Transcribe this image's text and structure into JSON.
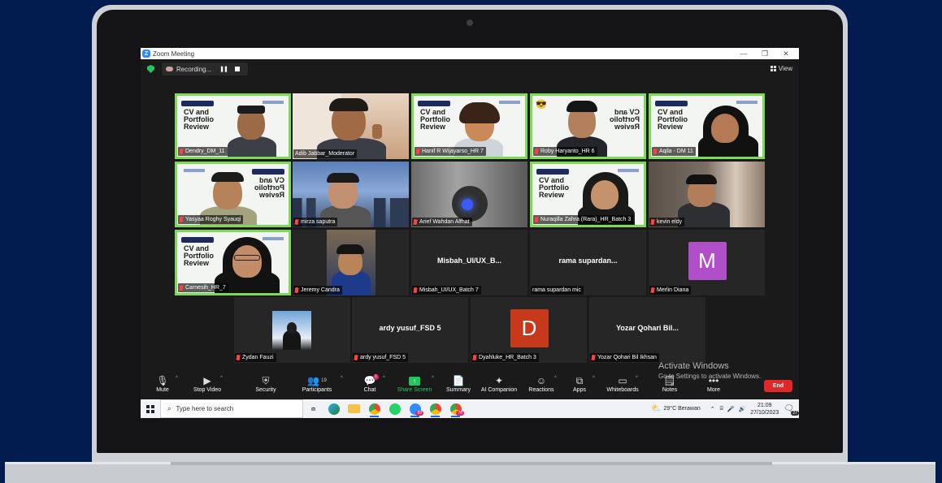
{
  "window": {
    "title": "Zoom Meeting",
    "min": "—",
    "max": "❐",
    "close": "✕"
  },
  "recording": {
    "label": "Recording...",
    "pause": "❚❚"
  },
  "view": {
    "label": "View"
  },
  "participants": [
    {
      "name": "Dendry_DM_11",
      "muted": true,
      "banner": "CV and\nPortfolio\nReview",
      "mirror": false
    },
    {
      "name": "Adib Jabbar_Moderator",
      "muted": false,
      "speaking": true
    },
    {
      "name": "Hanif R Wijayarso_HR 7",
      "muted": true,
      "banner": "CV and\nPortfolio\nReview",
      "mirror": false
    },
    {
      "name": "Roby Haryanto_HR 6",
      "muted": true,
      "banner": "CV and\nPortfolio\nReview",
      "mirror": true
    },
    {
      "name": "Aqila - DM 11",
      "muted": true,
      "banner": "CV and\nPortfolio\nReview",
      "mirror": false
    },
    {
      "name": "Yasyaa Roghy Syauqi",
      "muted": true,
      "banner": "CV and\nPortfolio\nReview",
      "mirror": true
    },
    {
      "name": "mirza saputra",
      "muted": true
    },
    {
      "name": "Arief Wahdan Alfhat",
      "muted": true
    },
    {
      "name": "Nuraqilla Zahra (Rara)_HR_Batch 3",
      "muted": true,
      "banner": "CV and\nPortfolio\nReview",
      "mirror": false
    },
    {
      "name": "kevin eldy",
      "muted": true
    },
    {
      "name": "Carnesih_HR_7",
      "muted": true,
      "banner": "CV and\nPortfolio\nReview",
      "mirror": false
    },
    {
      "name": "Jeremy Candra",
      "muted": true
    },
    {
      "name": "Misbah_UI/UX_Batch 7",
      "muted": true,
      "display": "Misbah_UI/UX_B..."
    },
    {
      "name": "rama supardan mic",
      "muted": false,
      "display": "rama supardan..."
    },
    {
      "name": "Merlin Diana",
      "muted": true,
      "avatar": "M",
      "avatar_color": "#b04fc9"
    },
    {
      "name": "Zydan Fauzi",
      "muted": true
    },
    {
      "name": "ardy yusuf_FSD 5",
      "muted": true,
      "display": "ardy yusuf_FSD 5"
    },
    {
      "name": "Dyahluke_HR_Batch 3",
      "muted": true,
      "avatar": "D",
      "avatar_color": "#c8391c"
    },
    {
      "name": "Yozar Qohari Bil Ikhsan",
      "muted": true,
      "display": "Yozar Qohari Bil..."
    }
  ],
  "toolbar": {
    "mute": "Mute",
    "video": "Stop Video",
    "security": "Security",
    "participants": "Participants",
    "participants_count": "19",
    "chat": "Chat",
    "chat_badge": "1",
    "share": "Share Screen",
    "summary": "Summary",
    "ai": "AI Companion",
    "reactions": "Reactions",
    "apps": "Apps",
    "whiteboards": "Whiteboards",
    "notes": "Notes",
    "more": "More",
    "end": "End"
  },
  "watermark": {
    "line1": "Activate Windows",
    "line2": "Go to Settings to activate Windows."
  },
  "taskbar": {
    "search_placeholder": "Type here to search",
    "weather": "29°C  Berawan",
    "time": "21:09",
    "date": "27/10/2023",
    "zoom_count": "99",
    "chrome2_count": "78",
    "notif_count": "27"
  },
  "colors": {
    "accent_green": "#7ed957",
    "end_red": "#e02828",
    "share_green": "#22c55e",
    "bg_navy": "#021b4e"
  }
}
